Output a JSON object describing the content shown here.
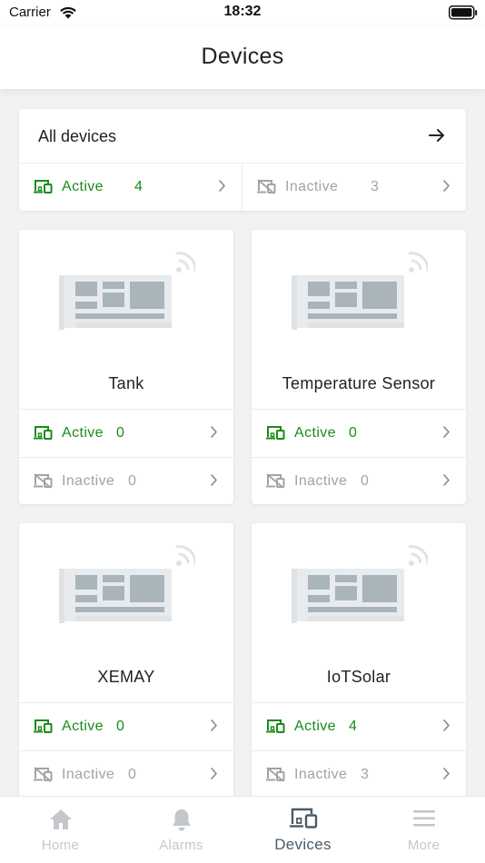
{
  "status_bar": {
    "carrier": "Carrier",
    "time": "18:32"
  },
  "header": {
    "title": "Devices"
  },
  "all_devices": {
    "title": "All devices",
    "active": {
      "label": "Active",
      "count": "4"
    },
    "inactive": {
      "label": "Inactive",
      "count": "3"
    }
  },
  "device_types": [
    {
      "name": "Tank",
      "active": {
        "label": "Active",
        "count": "0"
      },
      "inactive": {
        "label": "Inactive",
        "count": "0"
      }
    },
    {
      "name": "Temperature Sensor",
      "active": {
        "label": "Active",
        "count": "0"
      },
      "inactive": {
        "label": "Inactive",
        "count": "0"
      }
    },
    {
      "name": "XEMAY",
      "active": {
        "label": "Active",
        "count": "0"
      },
      "inactive": {
        "label": "Inactive",
        "count": "0"
      }
    },
    {
      "name": "IoTSolar",
      "active": {
        "label": "Active",
        "count": "4"
      },
      "inactive": {
        "label": "Inactive",
        "count": "3"
      }
    }
  ],
  "tabs": [
    {
      "label": "Home",
      "icon": "home-icon"
    },
    {
      "label": "Alarms",
      "icon": "bell-icon"
    },
    {
      "label": "Devices",
      "icon": "devices-icon",
      "selected": true
    },
    {
      "label": "More",
      "icon": "menu-icon"
    }
  ],
  "colors": {
    "active": "#1a8c1a",
    "inactive": "#a3a3a3",
    "tab_selected": "#4d5b68",
    "tab_inactive": "#c3c7cc"
  }
}
